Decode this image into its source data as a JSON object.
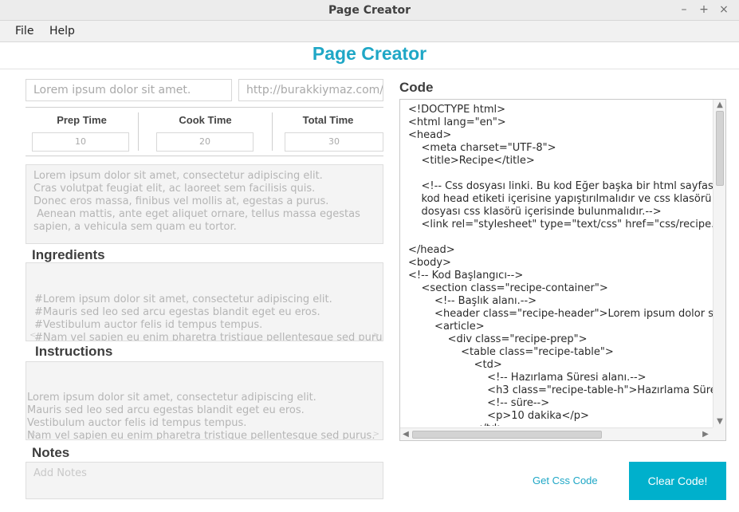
{
  "window": {
    "title": "Page Creator",
    "controls": [
      "–",
      "+",
      "×"
    ]
  },
  "menu": [
    "File",
    "Help"
  ],
  "header": {
    "title": "Page Creator"
  },
  "form": {
    "title_placeholder": "Lorem ipsum dolor sit amet.",
    "url_placeholder": "http://burakkiymaz.com/i",
    "times": [
      {
        "label": "Prep Time",
        "value": "10"
      },
      {
        "label": "Cook Time",
        "value": "20"
      },
      {
        "label": "Total Time",
        "value": "30"
      }
    ],
    "description": "Lorem ipsum dolor sit amet, consectetur adipiscing elit.\nCras volutpat feugiat elit, ac laoreet sem facilisis quis.\nDonec eros massa, finibus vel mollis at, egestas a purus.\n Aenean mattis, ante eget aliquet ornare, tellus massa egestas\nsapien, a vehicula sem quam eu tortor.",
    "ingredients_label": "Ingredients",
    "ingredients": "#Lorem ipsum dolor sit amet, consectetur adipiscing elit.\n#Mauris sed leo sed arcu egestas blandit eget eu eros.\n#Vestibulum auctor felis id tempus tempus.\n#Nam vel sapien eu enim pharetra tristique pellentesque sed purus.",
    "instructions_label": "Instructions",
    "instructions": "Lorem ipsum dolor sit amet, consectetur adipiscing elit.\nMauris sed leo sed arcu egestas blandit eget eu eros.\nVestibulum auctor felis id tempus tempus.\nNam vel sapien eu enim pharetra tristique pellentesque sed purus.",
    "notes_label": "Notes",
    "notes_placeholder": "Add Notes"
  },
  "code": {
    "label": "Code",
    "text": "<!DOCTYPE html>\n<html lang=\"en\">\n<head>\n    <meta charset=\"UTF-8\">\n    <title>Recipe</title>\n\n    <!-- Css dosyası linki. Bu kod Eğer başka bir html sayfası\n    kod head etiketi içerisine yapıştırılmalıdır ve css klasörü\n    dosyası css klasörü içerisinde bulunmalıdır.-->\n    <link rel=\"stylesheet\" type=\"text/css\" href=\"css/recipe.css\">\n\n</head>\n<body>\n<!-- Kod Başlangıcı-->\n    <section class=\"recipe-container\">\n        <!-- Başlık alanı.-->\n        <header class=\"recipe-header\">Lorem ipsum dolor sit amet.</header>\n        <article>\n            <div class=\"recipe-prep\">\n                <table class=\"recipe-table\">\n                    <td>\n                        <!-- Hazırlama Süresi alanı.-->\n                        <h3 class=\"recipe-table-h\">Hazırlama Süresi</h3>\n                        <!-- süre-->\n                        <p>10 dakika</p>\n                    </td>"
  },
  "actions": {
    "get_css": "Get Css Code",
    "clear": "Clear Code!"
  },
  "colors": {
    "accent": "#1fa7c6",
    "button": "#00b0cc"
  }
}
